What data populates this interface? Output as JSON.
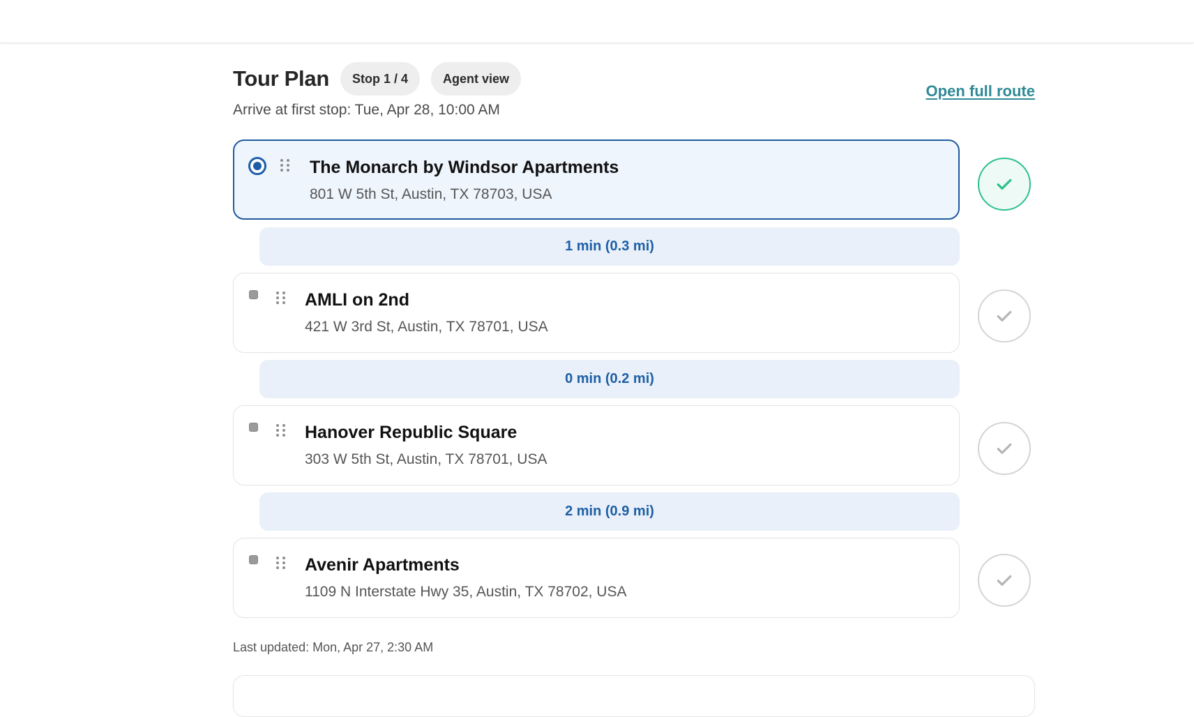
{
  "header": {
    "title": "Tour Plan",
    "stop_pill": "Stop 1 / 4",
    "view_pill": "Agent view",
    "subtitle": "Arrive at first stop: Tue, Apr 28, 10:00 AM",
    "open_route_label": "Open full route"
  },
  "stops": [
    {
      "name": "The Monarch by Windsor Apartments",
      "address": "801 W 5th St, Austin, TX 78703, USA",
      "selected": true,
      "complete": true
    },
    {
      "name": "AMLI on 2nd",
      "address": "421 W 3rd St, Austin, TX 78701, USA",
      "selected": false,
      "complete": false
    },
    {
      "name": "Hanover Republic Square",
      "address": "303 W 5th St, Austin, TX 78701, USA",
      "selected": false,
      "complete": false
    },
    {
      "name": "Avenir Apartments",
      "address": "1109 N Interstate Hwy 35, Austin, TX 78702, USA",
      "selected": false,
      "complete": false
    }
  ],
  "legs": [
    {
      "label": "1 min (0.3 mi)"
    },
    {
      "label": "0 min (0.2 mi)"
    },
    {
      "label": "2 min (0.9 mi)"
    }
  ],
  "footer": {
    "last_updated": "Last updated: Mon, Apr 27, 2:30 AM"
  },
  "icons": {
    "check": "check-icon",
    "drag": "drag-handle-icon",
    "radio": "radio-selected-icon"
  },
  "colors": {
    "accent": "#1d5da8",
    "link": "#2f8a96",
    "complete": "#2cc08a",
    "incomplete": "#b5b5b5"
  }
}
